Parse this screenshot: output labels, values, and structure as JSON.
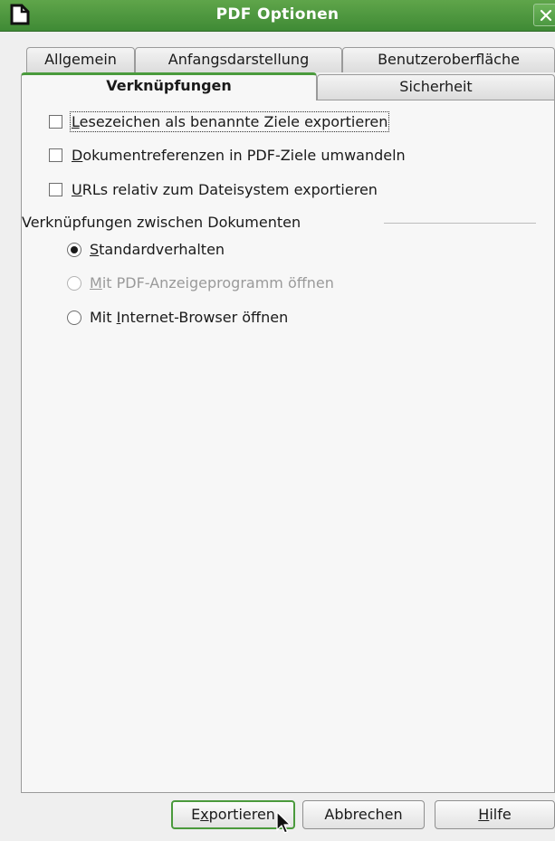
{
  "window": {
    "title": "PDF Optionen"
  },
  "tabs": [
    {
      "label": "Allgemein",
      "active": false
    },
    {
      "label": "Anfangsdarstellung",
      "active": false
    },
    {
      "label": "Benutzeroberfläche",
      "active": false
    },
    {
      "label": "Verknüpfungen",
      "active": true
    },
    {
      "label": "Sicherheit",
      "active": false
    }
  ],
  "options": {
    "checkboxes": [
      {
        "pre": "",
        "mnemonic": "L",
        "post": "esezeichen als benannte Ziele exportieren",
        "checked": false,
        "focused": true
      },
      {
        "pre": "",
        "mnemonic": "D",
        "post": "okumentreferenzen in PDF-Ziele umwandeln",
        "checked": false,
        "focused": false
      },
      {
        "pre": "",
        "mnemonic": "U",
        "post": "RLs relativ zum Dateisystem exportieren",
        "checked": false,
        "focused": false
      }
    ],
    "group_label": "Verknüpfungen zwischen Dokumenten",
    "radios": [
      {
        "pre": "",
        "mnemonic": "S",
        "post": "tandardverhalten",
        "selected": true,
        "enabled": true
      },
      {
        "pre": "",
        "mnemonic": "M",
        "post": "it PDF-Anzeigeprogramm öffnen",
        "selected": false,
        "enabled": false
      },
      {
        "pre": "Mit ",
        "mnemonic": "I",
        "post": "nternet-Browser öffnen",
        "selected": false,
        "enabled": true
      }
    ]
  },
  "buttons": {
    "export": {
      "pre": "E",
      "mnemonic": "x",
      "post": "portieren"
    },
    "cancel": {
      "pre": "Abbrechen",
      "mnemonic": "",
      "post": ""
    },
    "help": {
      "pre": "",
      "mnemonic": "H",
      "post": "ilfe"
    }
  },
  "colors": {
    "titlebar": "#4a9a3c",
    "active_tab_accent": "#4a9a3c",
    "window_bg": "#efefef"
  },
  "icons": {
    "app": "document-icon",
    "close": "close-icon",
    "cursor": "mouse-pointer-icon"
  }
}
